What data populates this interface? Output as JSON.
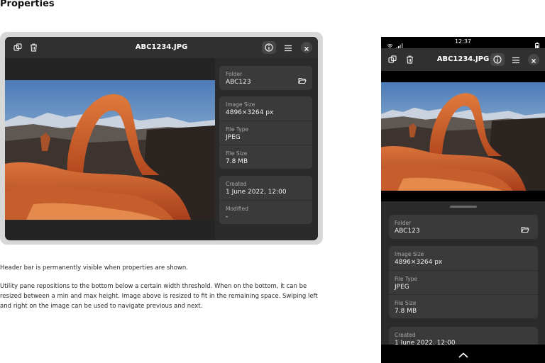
{
  "page": {
    "title": "Properties"
  },
  "window": {
    "title": "ABC1234.JPG",
    "properties": {
      "folder": {
        "label": "Folder",
        "value": "ABC123"
      },
      "image_size": {
        "label": "Image Size",
        "value": "4896×3264 px"
      },
      "file_type": {
        "label": "File Type",
        "value": "JPEG"
      },
      "file_size": {
        "label": "File Size",
        "value": "7.8 MB"
      },
      "created": {
        "label": "Created",
        "value": "1 June 2022, 12:00"
      },
      "modified": {
        "label": "Modified",
        "value": "-"
      }
    }
  },
  "description": {
    "para1": "Header bar is permanently visible when properties are shown.",
    "para2": "Utility pane repositions to the bottom below a certain width threshold. When on the bottom, it can be resized between a min and max height. Image above is resized to fit in the remaining space. Swiping left and right on the image can be used to navigate previous and next."
  },
  "phone": {
    "time": "12:37",
    "title": "ABC1234.JPG"
  },
  "icons": [
    "copy-icon",
    "trash-icon",
    "info-icon",
    "menu-icon",
    "close-icon",
    "folder-open-icon",
    "wifi-icon",
    "signal-icon",
    "battery-icon",
    "chevron-up-icon"
  ]
}
